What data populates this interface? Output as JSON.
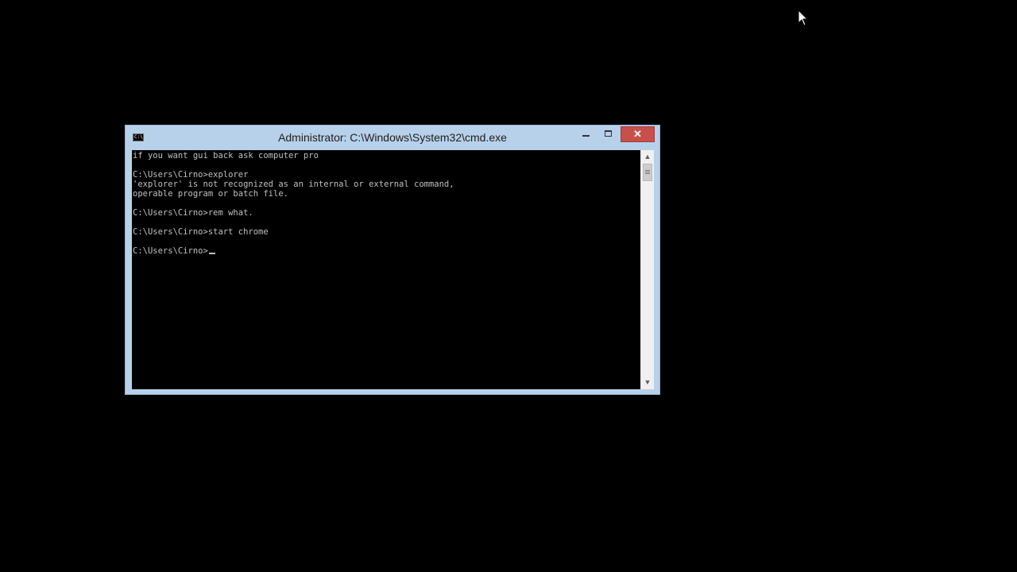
{
  "window": {
    "title": "Administrator: C:\\Windows\\System32\\cmd.exe",
    "icon_label": "C:\\",
    "controls": {
      "minimize": "minimize-icon",
      "maximize": "maximize-icon",
      "close": "close-icon"
    },
    "close_color": "#c7504a",
    "frame_color": "#b8d1ea"
  },
  "console": {
    "lines": [
      "if you want gui back ask computer pro",
      "",
      "C:\\Users\\Cirno>explorer",
      "'explorer' is not recognized as an internal or external command,",
      "operable program or batch file.",
      "",
      "C:\\Users\\Cirno>rem what.",
      "",
      "C:\\Users\\Cirno>start chrome",
      "",
      "C:\\Users\\Cirno>"
    ],
    "text_color": "#c0c0c0",
    "background": "#000000"
  },
  "scrollbar": {
    "up_icon": "chevron-up-icon",
    "down_icon": "chevron-down-icon",
    "up_glyph": "▲",
    "down_glyph": "▼"
  },
  "mouse_pointer": "mouse-pointer-icon"
}
